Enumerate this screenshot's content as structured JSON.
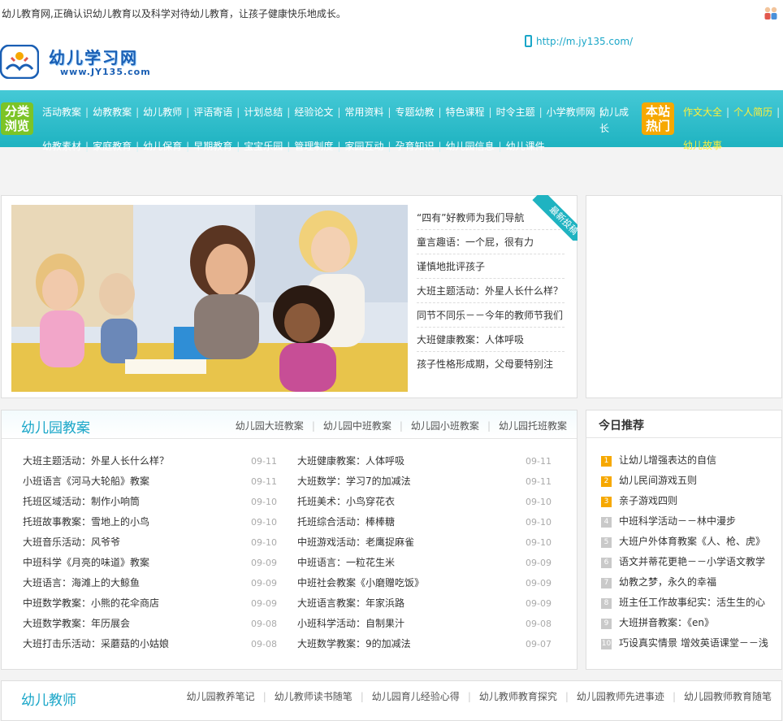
{
  "topbar": {
    "slogan": "幼儿教育网,正确认识幼儿教育以及科学对待幼儿教育，让孩子健康快乐地成长。",
    "icon": "people-icon"
  },
  "header": {
    "logo_name": "幼儿学习网",
    "logo_url": "www.JY135.com",
    "mobile_url": "http://m.jy135.com/"
  },
  "nav": {
    "category_tag": "分类浏览",
    "row1": [
      "活动教案",
      "幼教教案",
      "幼儿教师",
      "评语寄语",
      "计划总结",
      "经验论文",
      "常用资料",
      "专题幼教",
      "特色课程",
      "时令主题",
      "小学教师网"
    ],
    "row1_extra": "幼儿成长",
    "row2": [
      "幼教素材",
      "家庭教育",
      "幼儿保育",
      "早期教育",
      "宝宝乐园",
      "管理制度",
      "家园互动",
      "孕育知识",
      "幼儿园信息",
      "幼儿课件"
    ],
    "hot_tag": "本站热门",
    "hot_links": [
      "作文大全",
      "个人简历"
    ],
    "hot_extra": "幼儿故事"
  },
  "latest": {
    "ribbon": "最新投稿",
    "items": [
      "“四有”好教师为我们导航",
      "童言趣语：一个屁，很有力",
      "谨慎地批评孩子",
      "大班主题活动：外星人长什么样？",
      "同节不同乐－－今年的教师节我们",
      "大班健康教案：人体呼吸",
      "孩子性格形成期，父母要特别注"
    ]
  },
  "lesson_section": {
    "title": "幼儿园教案",
    "tabs": [
      "幼儿园大班教案",
      "幼儿园中班教案",
      "幼儿园小班教案",
      "幼儿园托班教案"
    ],
    "left": [
      {
        "title": "大班主题活动：外星人长什么样？",
        "date": "09-11"
      },
      {
        "title": "小班语言《河马大轮船》教案",
        "date": "09-11"
      },
      {
        "title": "托班区域活动：制作小响筒",
        "date": "09-10"
      },
      {
        "title": "托班故事教案：雪地上的小鸟",
        "date": "09-10"
      },
      {
        "title": "大班音乐活动：风爷爷",
        "date": "09-10"
      },
      {
        "title": "中班科学《月亮的味道》教案",
        "date": "09-09"
      },
      {
        "title": "大班语言：海滩上的大鲸鱼",
        "date": "09-09"
      },
      {
        "title": "中班数学教案：小熊的花伞商店",
        "date": "09-09"
      },
      {
        "title": "大班数学教案：年历展会",
        "date": "09-08"
      },
      {
        "title": "大班打击乐活动：采蘑菇的小姑娘",
        "date": "09-08"
      }
    ],
    "right": [
      {
        "title": "大班健康教案：人体呼吸",
        "date": "09-11"
      },
      {
        "title": "大班数学：学习7的加减法",
        "date": "09-11"
      },
      {
        "title": "托班美术：小鸟穿花衣",
        "date": "09-10"
      },
      {
        "title": "托班综合活动：棒棒糖",
        "date": "09-10"
      },
      {
        "title": "中班游戏活动：老鹰捉麻雀",
        "date": "09-10"
      },
      {
        "title": "中班语言：一粒花生米",
        "date": "09-09"
      },
      {
        "title": "中班社会教案《小磨赠吃饭》",
        "date": "09-09"
      },
      {
        "title": "大班语言教案：年家浜路",
        "date": "09-09"
      },
      {
        "title": "小班科学活动：自制果汁",
        "date": "09-08"
      },
      {
        "title": "大班数学教案：9的加减法",
        "date": "09-07"
      }
    ]
  },
  "recommend": {
    "title": "今日推荐",
    "items": [
      {
        "num": "1",
        "title": "让幼儿增强表达的自信"
      },
      {
        "num": "2",
        "title": "幼儿民间游戏五则"
      },
      {
        "num": "3",
        "title": "亲子游戏四则"
      },
      {
        "num": "4",
        "title": "中班科学活动－－林中漫步"
      },
      {
        "num": "5",
        "title": "大班户外体育教案《人、枪、虎》"
      },
      {
        "num": "6",
        "title": "语文并蒂花更艳－－小学语文教学"
      },
      {
        "num": "7",
        "title": "幼教之梦，永久的幸福"
      },
      {
        "num": "8",
        "title": "班主任工作故事纪实：活生生的心"
      },
      {
        "num": "9",
        "title": "大班拼音教案：《en》"
      },
      {
        "num": "10",
        "title": "巧设真实情景 增效英语课堂－－浅"
      }
    ]
  },
  "teacher_section": {
    "title": "幼儿教师",
    "tabs": [
      "幼儿园教养笔记",
      "幼儿教师读书随笔",
      "幼儿园育儿经验心得",
      "幼儿教师教育探究",
      "幼儿园教师先进事迹",
      "幼儿园教师教育随笔"
    ]
  },
  "colors": {
    "accent": "#1fb3c1",
    "tag_green": "#7cc427",
    "tag_orange": "#f6a800",
    "hot_link": "#ffef3a"
  }
}
